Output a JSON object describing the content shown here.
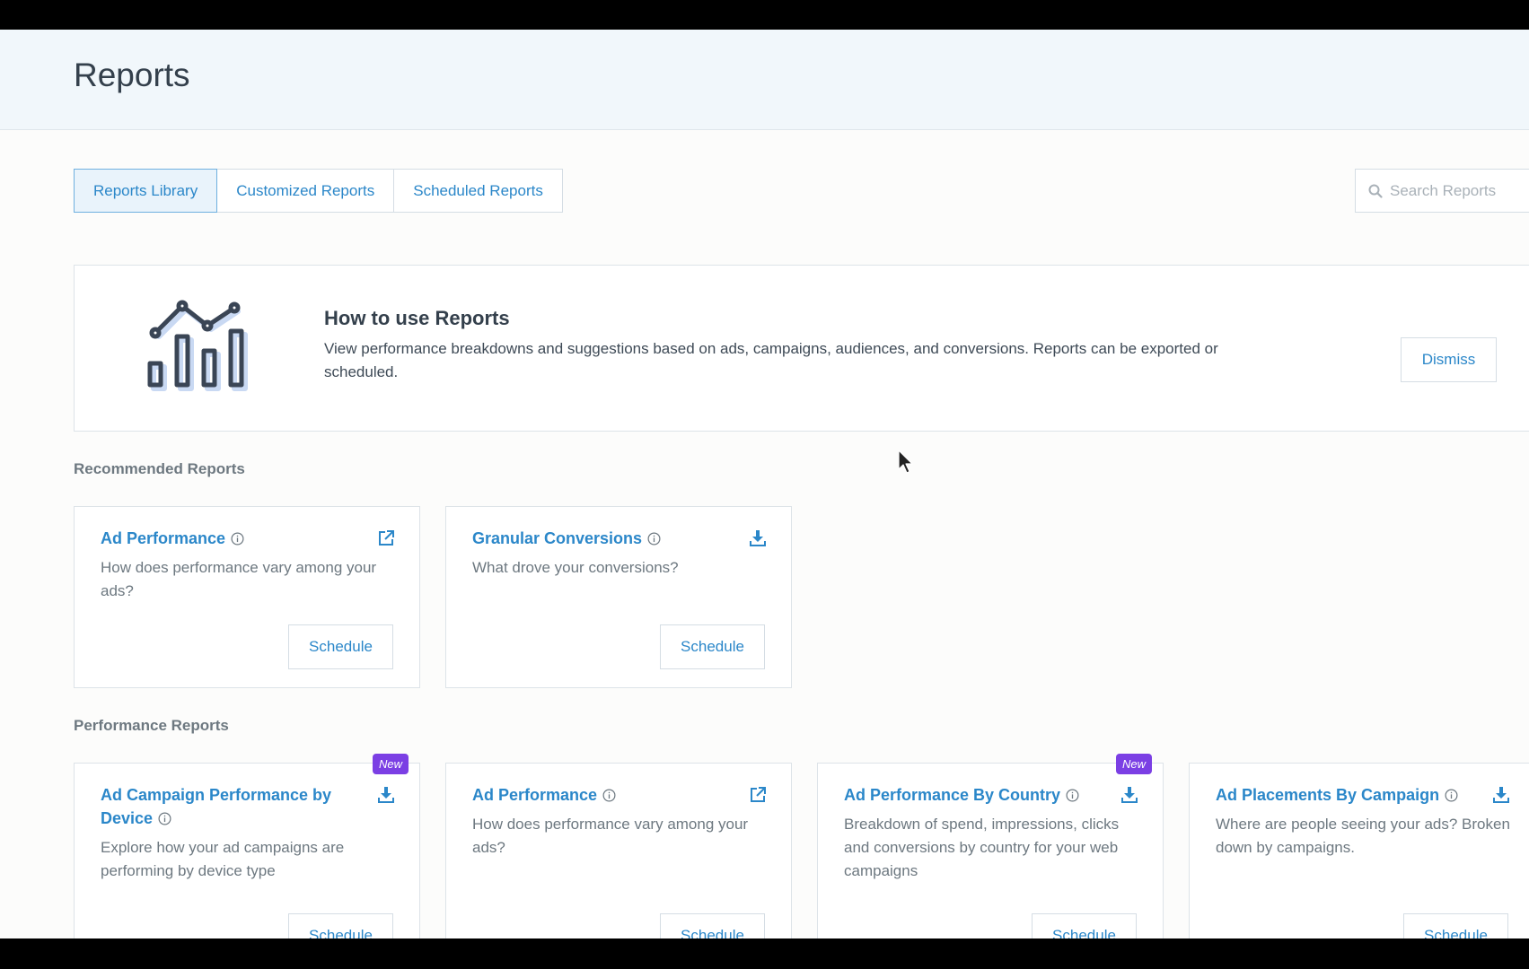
{
  "page": {
    "title": "Reports"
  },
  "tabs": [
    {
      "label": "Reports Library",
      "active": true
    },
    {
      "label": "Customized Reports",
      "active": false
    },
    {
      "label": "Scheduled Reports",
      "active": false
    }
  ],
  "search": {
    "placeholder": "Search Reports",
    "value": ""
  },
  "how_to": {
    "title": "How to use Reports",
    "body": "View performance breakdowns and suggestions based on ads, campaigns, audiences, and conversions. Reports can be exported or scheduled.",
    "dismiss_label": "Dismiss"
  },
  "recommended": {
    "heading": "Recommended Reports",
    "cards": [
      {
        "title": "Ad Performance",
        "description": "How does performance vary among your ads?",
        "action_icon": "external-link-icon",
        "schedule_label": "Schedule"
      },
      {
        "title": "Granular Conversions",
        "description": "What drove your conversions?",
        "action_icon": "download-icon",
        "schedule_label": "Schedule"
      }
    ]
  },
  "performance": {
    "heading": "Performance Reports",
    "cards": [
      {
        "title": "Ad Campaign Performance by Device",
        "badge": "New",
        "description": "Explore how your ad campaigns are performing by device type",
        "action_icon": "download-icon",
        "schedule_label": "Schedule"
      },
      {
        "title": "Ad Performance",
        "description": "How does performance vary among your ads?",
        "action_icon": "external-link-icon",
        "schedule_label": "Schedule"
      },
      {
        "title": "Ad Performance By Country",
        "badge": "New",
        "description": "Breakdown of spend, impressions, clicks and conversions by country for your web campaigns",
        "action_icon": "download-icon",
        "schedule_label": "Schedule"
      },
      {
        "title": "Ad Placements By Campaign",
        "description": "Where are people seeing your ads? Broken down by campaigns.",
        "action_icon": "download-icon",
        "schedule_label": "Schedule"
      }
    ]
  },
  "colors": {
    "accent": "#2b87c9",
    "badge": "#7b3fe4",
    "header_bg": "#f1f7fb"
  }
}
